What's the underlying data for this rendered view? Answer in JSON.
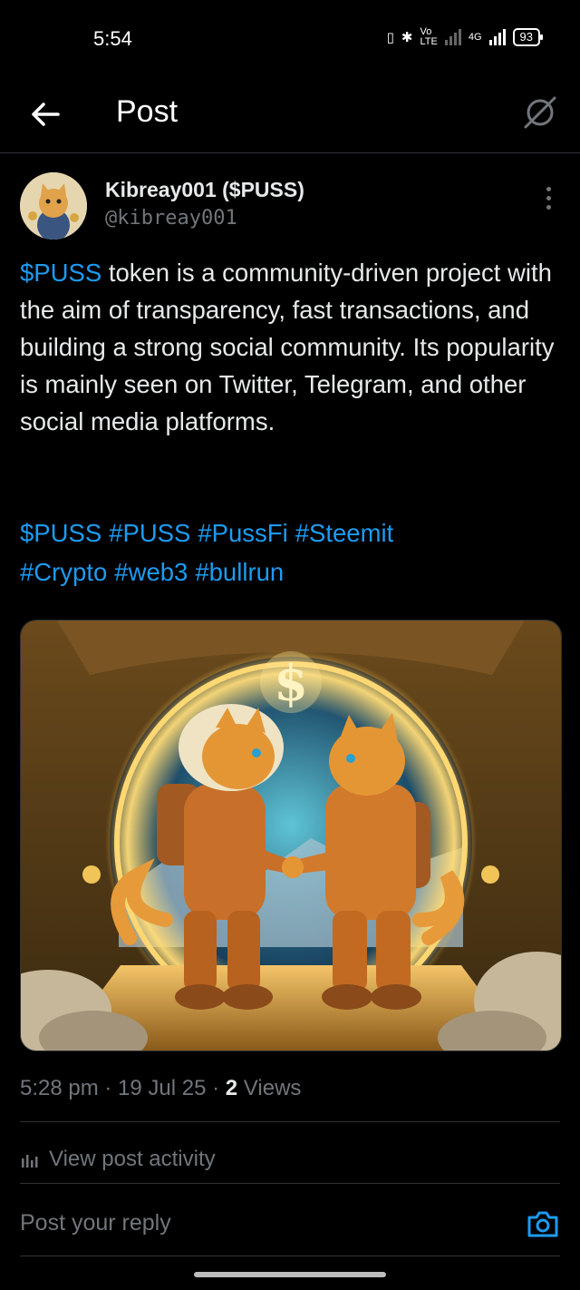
{
  "status_bar": {
    "time": "5:54",
    "volte": "Vo\nLTE",
    "network": "4G",
    "battery": "93"
  },
  "header": {
    "title": "Post"
  },
  "post": {
    "author_name": "Kibreay001 ($PUSS)",
    "author_handle": "@kibreay001",
    "text_link": "$PUSS",
    "text_rest": " token is a community-driven project with the aim of transparency, fast transactions, and building a strong social community. Its popularity is mainly seen on Twitter, Telegram, and other social media platforms.",
    "tags": [
      "$PUSS",
      "#PUSS",
      "#PussFi",
      "#Steemit",
      "#Crypto",
      "#web3",
      "#bullrun"
    ],
    "timestamp": "5:28 pm · 19 Jul 25 · ",
    "views_count": "2",
    "views_label": " Views",
    "activity_label": "View post activity"
  },
  "reply": {
    "placeholder": "Post your reply"
  },
  "colors": {
    "accent": "#1d9bf0",
    "muted": "#71767b",
    "background": "#000000"
  }
}
